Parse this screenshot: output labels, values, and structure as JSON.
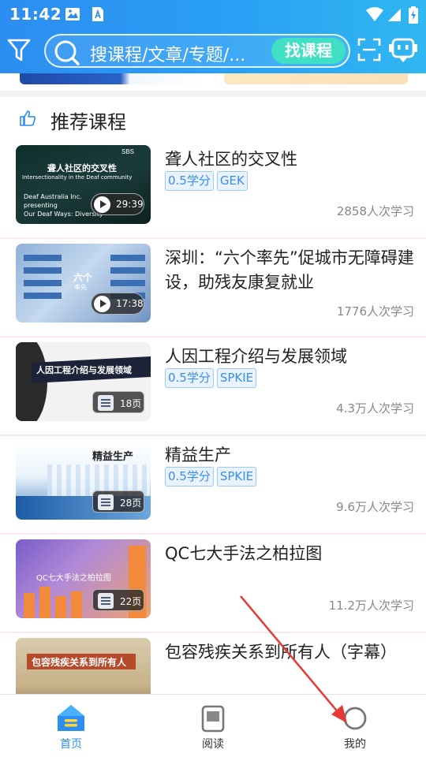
{
  "status_bar": {
    "time": "11:42"
  },
  "header": {
    "search_placeholder": "搜课程/文章/专题/...",
    "search_button": "找课程",
    "colors": {
      "header_start": "#2c8df0",
      "header_end": "#30b7f0",
      "search_button": "#41e0c4"
    }
  },
  "section": {
    "title": "推荐课程"
  },
  "courses": [
    {
      "title": "聋人社区的交叉性",
      "tags": [
        "0.5学分",
        "GEK"
      ],
      "learners": "2858人次学习",
      "type": "video",
      "duration": "29:39",
      "thumb_text": [
        "聋人社区的交叉性",
        "Intersectionality in the Deaf community",
        "Deaf Australia Inc.",
        "presenting",
        "Our Deaf Ways: Diversity"
      ],
      "thumb_logo": "SBS"
    },
    {
      "title": "深圳：“六个率先”促城市无障碍建设，助残友康复就业",
      "tags": [],
      "learners": "1776人次学习",
      "type": "video",
      "duration": "17:38",
      "thumb_text": [
        "六个",
        "率先"
      ]
    },
    {
      "title": "人因工程介绍与发展领域",
      "tags": [
        "0.5学分",
        "SPKIE"
      ],
      "learners": "4.3万人次学习",
      "type": "doc",
      "pages": "18页",
      "thumb_text": [
        "人因工程介绍与发展领域"
      ]
    },
    {
      "title": "精益生产",
      "tags": [
        "0.5学分",
        "SPKIE"
      ],
      "learners": "9.6万人次学习",
      "type": "doc",
      "pages": "28页",
      "thumb_text": [
        "精益生产"
      ]
    },
    {
      "title": "QC七大手法之柏拉图",
      "tags": [],
      "learners": "11.2万人次学习",
      "type": "doc",
      "pages": "22页",
      "thumb_text": [
        "QC七大手法之柏拉图"
      ]
    },
    {
      "title": "包容残疾关系到所有人（字幕）",
      "tags": [],
      "learners": "",
      "type": "video",
      "duration": "",
      "thumb_text": [
        "包容残疾关系到所有人"
      ]
    }
  ],
  "nav": [
    {
      "label": "首页",
      "icon": "home-icon",
      "active": true
    },
    {
      "label": "阅读",
      "icon": "reading-icon",
      "active": false
    },
    {
      "label": "我的",
      "icon": "profile-icon",
      "active": false
    }
  ],
  "annotation": {
    "arrow_color": "#e53935"
  }
}
